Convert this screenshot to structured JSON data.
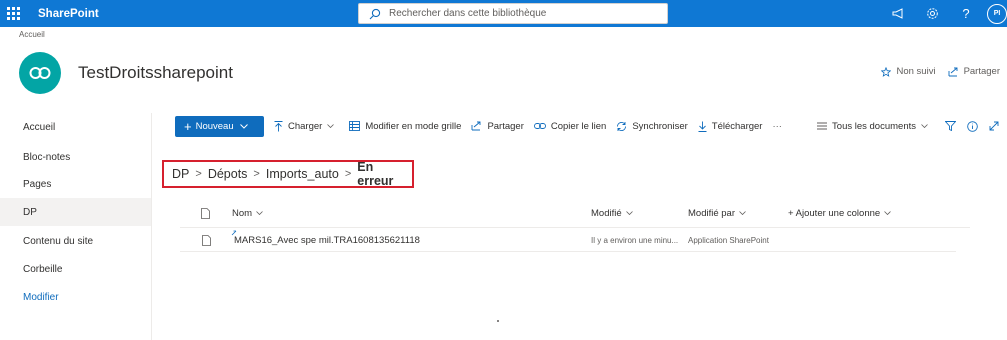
{
  "suite": {
    "app_name": "SharePoint",
    "search_placeholder": "Rechercher dans cette bibliothèque",
    "avatar_initials": "PI",
    "help_label": "?"
  },
  "site": {
    "breadcrumb": "Accueil",
    "title": "TestDroitssharepoint",
    "follow_label": "Non suivi",
    "share_label": "Partager",
    "logo_color": "#03a5a5"
  },
  "nav": {
    "items": [
      {
        "label": "Accueil"
      },
      {
        "label": "Bloc-notes"
      },
      {
        "label": "Pages"
      },
      {
        "label": "DP"
      },
      {
        "label": "Contenu du site"
      },
      {
        "label": "Corbeille"
      },
      {
        "label": "Modifier"
      }
    ]
  },
  "commands": {
    "new_label": "Nouveau",
    "upload_label": "Charger",
    "grid_label": "Modifier en mode grille",
    "share_label": "Partager",
    "copy_link_label": "Copier le lien",
    "sync_label": "Synchroniser",
    "download_label": "Télécharger",
    "more_label": "···",
    "view_label": "Tous les documents"
  },
  "breadcrumb": {
    "items": [
      "DP",
      "Dépots",
      "Imports_auto"
    ],
    "current": "En erreur",
    "separator": ">"
  },
  "list": {
    "columns": {
      "name": "Nom",
      "modified": "Modifié",
      "modified_by": "Modifié par",
      "add_column": "+ Ajouter une colonne"
    },
    "rows": [
      {
        "name": "MARS16_Avec spe mil.TRA1608135621118",
        "modified": "Il y a environ une minu...",
        "modified_by": "Application SharePoint"
      }
    ]
  },
  "colors": {
    "suite_bar": "#0f78d4",
    "primary_button": "#0f6cbd",
    "highlight_border": "#d6202e"
  }
}
